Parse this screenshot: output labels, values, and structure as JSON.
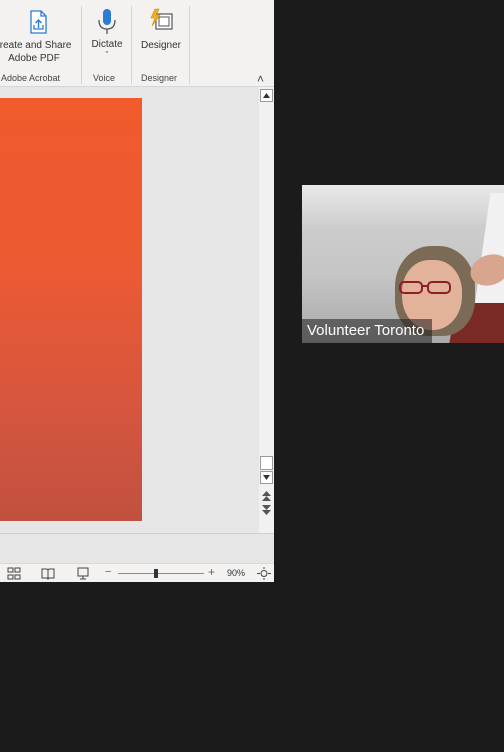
{
  "ribbon": {
    "groups": [
      {
        "label": "Adobe Acrobat",
        "button": {
          "label_line1": "Create and Share",
          "label_line2": "Adobe PDF",
          "icon": "pdf-share-icon"
        }
      },
      {
        "label": "Voice",
        "button": {
          "label": "Dictate",
          "dropdown": "ˇ",
          "icon": "microphone-icon"
        }
      },
      {
        "label": "Designer",
        "button": {
          "label": "Designer",
          "icon": "designer-icon"
        }
      }
    ],
    "collapse_glyph": "˄"
  },
  "document": {
    "page_color_top": "#f05a2c",
    "page_color_bottom": "#c0513f"
  },
  "statusbar": {
    "zoom_minus": "−",
    "zoom_plus": "+",
    "zoom_level": "90%",
    "zoom_fraction": 0.45
  },
  "video": {
    "participant_name": "Volunteer Toronto"
  },
  "colors": {
    "accent": "#2b7cd3",
    "background": "#1b1b1b"
  }
}
